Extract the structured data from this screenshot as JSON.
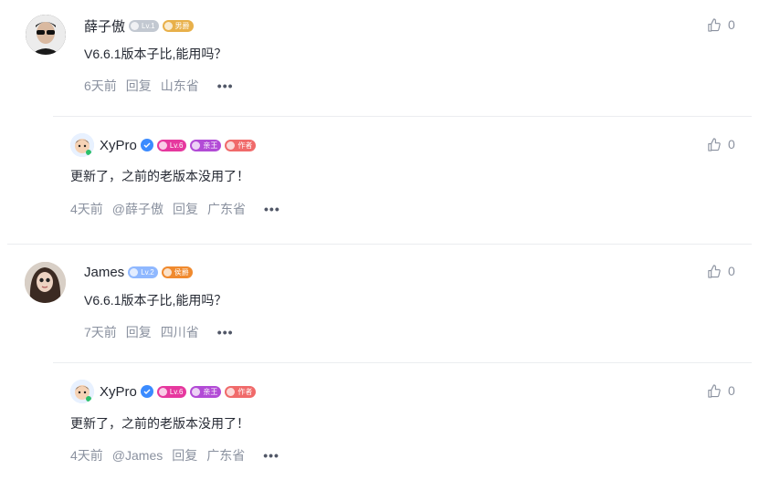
{
  "colors": {
    "accent": "#1e80ff",
    "level_gray": "#c2c8d1",
    "level_blue": "#8fb8ff",
    "level_pink": "#e6389e",
    "muted_text": "#8a919f"
  },
  "comments": [
    {
      "username": "薛子傲",
      "level": "Lv.1",
      "tag": "男爵",
      "text": "V6.6.1版本子比,能用吗？",
      "time": "6天前",
      "reply_label": "回复",
      "location": "山东省",
      "likes": "0",
      "reply": {
        "username": "XyPro",
        "level": "Lv.6",
        "tag1": "亲王",
        "tag2": "作者",
        "text": "更新了，之前的老版本没用了！",
        "time": "4天前",
        "mention": "@薛子傲",
        "reply_label": "回复",
        "location": "广东省",
        "likes": "0"
      }
    },
    {
      "username": "James",
      "level": "Lv.2",
      "tag": "侯爵",
      "text": "V6.6.1版本子比,能用吗？",
      "time": "7天前",
      "reply_label": "回复",
      "location": "四川省",
      "likes": "0",
      "reply": {
        "username": "XyPro",
        "level": "Lv.6",
        "tag1": "亲王",
        "tag2": "作者",
        "text": "更新了，之前的老版本没用了！",
        "time": "4天前",
        "mention": "@James",
        "reply_label": "回复",
        "location": "广东省",
        "likes": "0"
      }
    }
  ]
}
